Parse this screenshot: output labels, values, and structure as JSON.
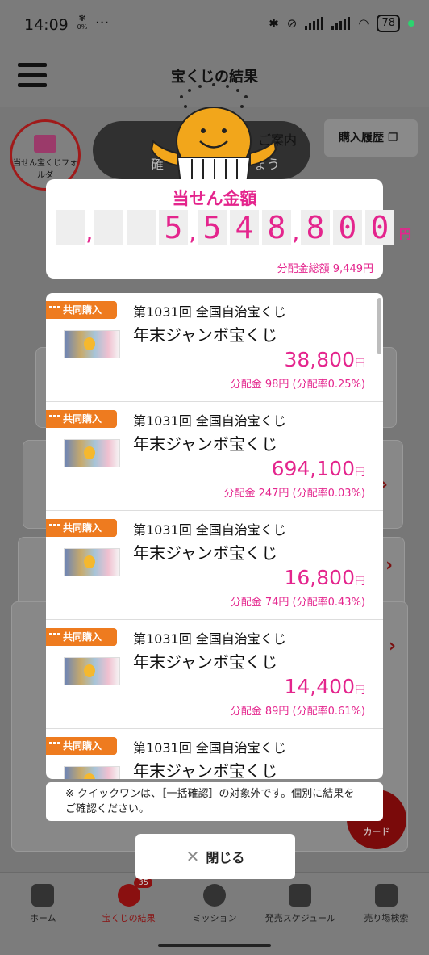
{
  "status_bar": {
    "time": "14:09",
    "fan_percent": "0%",
    "more": "···",
    "battery": "78"
  },
  "header": {
    "title": "宝くじの結果"
  },
  "background": {
    "folder_label": "当せん宝くじフォルダ",
    "banner_line1": "確",
    "banner_line2": "ょう",
    "guide_label": "ご案内",
    "history_label": "購入履歴",
    "card_label": "カード"
  },
  "modal": {
    "title": "当せん金額",
    "digits": [
      "",
      "",
      "",
      "5",
      "5",
      "4",
      "8",
      "8",
      "0",
      "0"
    ],
    "yen": "円",
    "total_distribution": "分配金総額 9,449円",
    "items": [
      {
        "tag": "共同購入",
        "round": "第1031回 全国自治宝くじ",
        "name": "年末ジャンボ宝くじ",
        "amount": "38,800",
        "unit": "円",
        "share": "分配金 98円 (分配率0.25%)"
      },
      {
        "tag": "共同購入",
        "round": "第1031回 全国自治宝くじ",
        "name": "年末ジャンボ宝くじ",
        "amount": "694,100",
        "unit": "円",
        "share": "分配金 247円 (分配率0.03%)"
      },
      {
        "tag": "共同購入",
        "round": "第1031回 全国自治宝くじ",
        "name": "年末ジャンボ宝くじ",
        "amount": "16,800",
        "unit": "円",
        "share": "分配金 74円 (分配率0.43%)"
      },
      {
        "tag": "共同購入",
        "round": "第1031回 全国自治宝くじ",
        "name": "年末ジャンボ宝くじ",
        "amount": "14,400",
        "unit": "円",
        "share": "分配金 89円 (分配率0.61%)"
      },
      {
        "tag": "共同購入",
        "round": "第1031回 全国自治宝くじ",
        "name": "年末ジャンボ宝くじ",
        "amount": "",
        "unit": "",
        "share": ""
      }
    ],
    "note": "※ クイックワンは、［一括確認］の対象外です。個別に結果をご確認ください。",
    "close_label": "閉じる"
  },
  "bottom_nav": [
    {
      "label": "ホーム",
      "icon": "home-icon"
    },
    {
      "label": "宝くじの結果",
      "icon": "target-icon",
      "badge": "35",
      "active": true
    },
    {
      "label": "ミッション",
      "icon": "mission-check-icon"
    },
    {
      "label": "発売スケジュール",
      "icon": "calendar-icon"
    },
    {
      "label": "売り場検索",
      "icon": "store-icon"
    }
  ],
  "colors": {
    "accent_pink": "#e4258d",
    "tag_orange": "#ee7b1f",
    "nav_active": "#8a1010"
  }
}
